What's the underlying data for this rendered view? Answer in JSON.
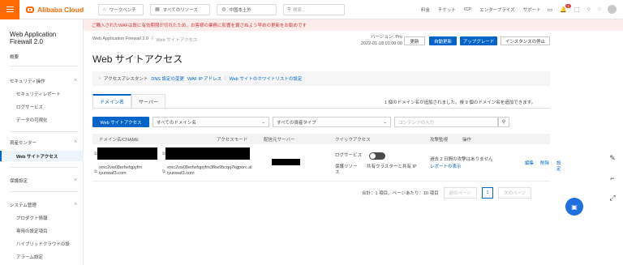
{
  "topbar": {
    "brand": "Alibaba Cloud",
    "workbench": "ワークベンチ",
    "resources": "すべてのリソース",
    "region": "中国本土外",
    "search_placeholder": "検索...",
    "links": [
      "料金",
      "チケット",
      "ICP",
      "エンタープライズ",
      "サポート"
    ],
    "notifications_badge": "1"
  },
  "sidebar": {
    "product_title": "Web Application Firewall 2.0",
    "overview": "概要",
    "security_ops": "セキュリティ操作",
    "security_report": "セキュリティレポート",
    "log_service": "ログサービス",
    "data_viz": "データの可視化",
    "asset_center": "資産センター",
    "web_site_access": "Web サイトアクセス",
    "protection_settings": "保護設定",
    "system_mgmt": "システム管理",
    "product_info": "プロダクト情報",
    "dedicated_settings": "専用の設定項目",
    "hybrid_cloud": "ハイブリッドクラウドの設",
    "alarm_settings": "アラーム設定"
  },
  "notice": "ご購入されたWAFは既に有効期限が切れたため、お客様の業務に影響を齎さぬよう早めの更新をお勧めです",
  "breadcrumb": {
    "root": "Web Application Firewall 2.0",
    "sep": "/",
    "current": "Web サイトアクセス"
  },
  "page_title": "Web サイトアクセス",
  "version": {
    "label": "バージョン: Pro",
    "date": "2022-01-18 01:00:00"
  },
  "header_buttons": {
    "renew": "更新",
    "auto_renew": "自動更新",
    "upgrade": "アップグレード",
    "stop_instance": "インスタンスの停止"
  },
  "assistant": {
    "title": "アクセスアシスタント",
    "link1": "DNS 設定の変更",
    "link2": "WAF IP アドレス",
    "sep": "|",
    "link3": "Web サイトのホワイトリストの設定"
  },
  "tabs": [
    "ドメイン名",
    "サーバー"
  ],
  "count_note": "1 個のドメイン名が追加されました。後 9 個のドメイン名を追加できます。",
  "filters": {
    "add_button": "Web サイトアクセス",
    "domain_select": "すべてのドメイン名",
    "asset_select": "すべての資産タイプ",
    "search_placeholder": "コンテンツの入力"
  },
  "table": {
    "headers": [
      "ドメイン名/CNAME",
      "アクセスモード",
      "配信元サーバー",
      "クイックアクセス",
      "攻撃監視",
      "操作"
    ],
    "row": {
      "cname1": "xmc2vw08erfwfqpyfm",
      "cname1b": "iyunwaf3.com",
      "cname2": "xmc2vw08erfwfqpyfm3fkw9bcqq7kgporc.al",
      "cname2b": "iyunwaf3.com",
      "log_service_label": "ログサービス",
      "protection_label": "保護リソース",
      "protection_value": "共有クラスターと共有 IP",
      "attack_text": "過去 2 日間の攻撃はありません",
      "report_link": "レポートの表示",
      "actions": [
        "編集",
        "削除",
        "設定"
      ]
    }
  },
  "pagination": {
    "summary": "合計：1 項目、ページあたり：10 項目",
    "prev": "前のページ",
    "page": "1",
    "next": "次のページ"
  }
}
